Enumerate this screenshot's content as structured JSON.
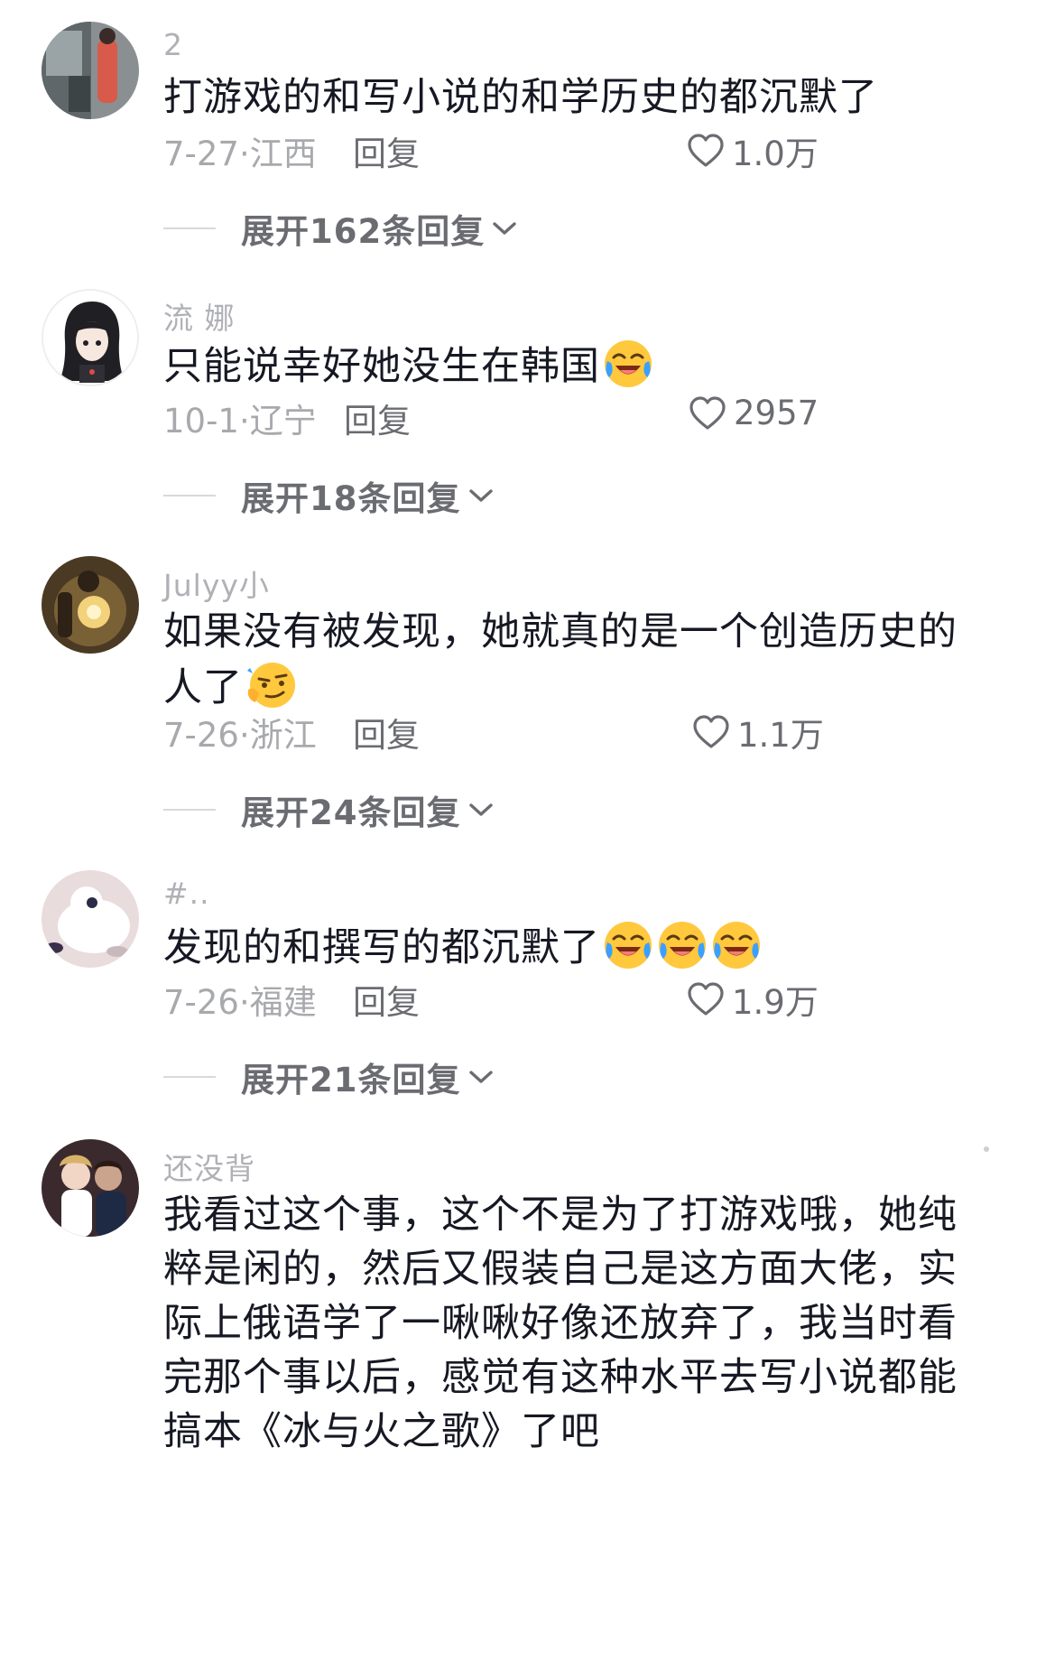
{
  "comments": [
    {
      "username": "2",
      "text": "打游戏的和写小说的和学历史的都沉默了",
      "emoji_count": 0,
      "date": "7-27·江西",
      "reply_label": "回复",
      "likes": "1.0万",
      "expand_label": "展开162条回复",
      "avatar_icon": "photo-street-avatar"
    },
    {
      "username": "流 娜",
      "text": "只能说幸好她没生在韩国",
      "emoji_count": 1,
      "date": "10-1·辽宁",
      "reply_label": "回复",
      "likes": "2957",
      "expand_label": "展开18条回复",
      "avatar_icon": "cartoon-girl-avatar"
    },
    {
      "username": "Julyy小",
      "text": "如果没有被发现，她就真的是一个创造历史的人了",
      "emoji_count": 1,
      "date": "7-26·浙江",
      "reply_label": "回复",
      "likes": "1.1万",
      "expand_label": "展开24条回复",
      "avatar_icon": "glowing-figure-avatar"
    },
    {
      "username": "#..",
      "text": "发现的和撰写的都沉默了",
      "emoji_count": 3,
      "date": "7-26·福建",
      "reply_label": "回复",
      "likes": "1.9万",
      "expand_label": "展开21条回复",
      "avatar_icon": "white-cat-avatar"
    },
    {
      "username": "还没背",
      "text": "我看过这个事，这个不是为了打游戏哦，她纯粹是闲的，然后又假装自己是这方面大佬，实际上俄语学了一啾啾好像还放弃了，我当时看完那个事以后，感觉有这种水平去写小说都能搞本《冰与火之歌》了吧",
      "emoji_count": 0,
      "avatar_icon": "couple-photo-avatar"
    }
  ],
  "colors": {
    "text_primary": "#161823",
    "text_secondary": "#a8a9ad",
    "text_action": "#6b6c72",
    "divider": "#d9d9dc",
    "emoji_yellow": "#ffc83d",
    "emoji_tear": "#3aa0ff"
  },
  "icons": {
    "like": "heart-outline-icon",
    "expand": "chevron-down-icon",
    "emoji_laugh_cry": "laugh-cry-emoji",
    "emoji_smirk": "smirk-emoji"
  }
}
